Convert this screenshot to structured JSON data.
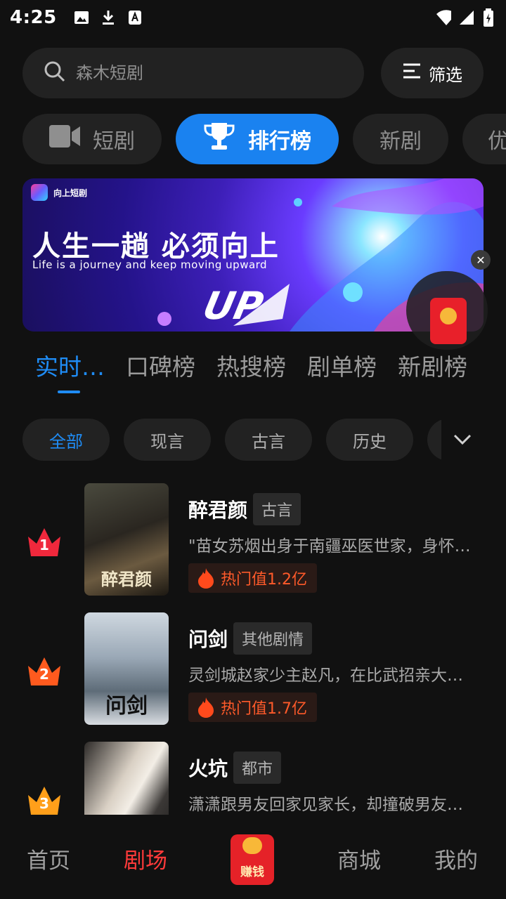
{
  "status_bar": {
    "time": "4:25"
  },
  "search": {
    "placeholder": "森木短剧",
    "filter_label": "筛选"
  },
  "categories": [
    {
      "label": "短剧",
      "icon": "video-camera-icon"
    },
    {
      "label": "排行榜",
      "icon": "trophy-icon"
    },
    {
      "label": "新剧"
    },
    {
      "label": "优"
    }
  ],
  "banner": {
    "brand": "向上短剧",
    "title": "人生一趟  必须向上",
    "subtitle": "Life is a journey and  keep moving upward",
    "logo_text": "UP"
  },
  "rank_tabs": [
    "实时…",
    "口碑榜",
    "热搜榜",
    "剧单榜",
    "新剧榜"
  ],
  "genres": [
    "全部",
    "现言",
    "古言",
    "历史"
  ],
  "dramas": [
    {
      "rank": "1",
      "title": "醉君颜",
      "tag": "古言",
      "poster_title": "醉君颜",
      "desc": "\"苗女苏烟出身于南疆巫医世家，身怀秘术",
      "heat": "热门值1.2亿",
      "crown_color": "#f0283c"
    },
    {
      "rank": "2",
      "title": "问剑",
      "tag": "其他剧情",
      "poster_title": "问剑",
      "desc": "灵剑城赵家少主赵凡，在比武招亲大会上",
      "heat": "热门值1.7亿",
      "crown_color": "#ff5a1e"
    },
    {
      "rank": "3",
      "title": "火坑",
      "tag": "都市",
      "poster_title": "",
      "desc": "潇潇跟男友回家见家长，却撞破男友秘密",
      "heat": "",
      "crown_color": "#ff9f1a"
    }
  ],
  "bottom_nav": {
    "home": "首页",
    "theater": "剧场",
    "earn": "赚钱",
    "mall": "商城",
    "mine": "我的"
  },
  "colors": {
    "accent_blue": "#1a82f0",
    "nav_active": "#ff3a3a",
    "heat": "#ff5a2a"
  }
}
